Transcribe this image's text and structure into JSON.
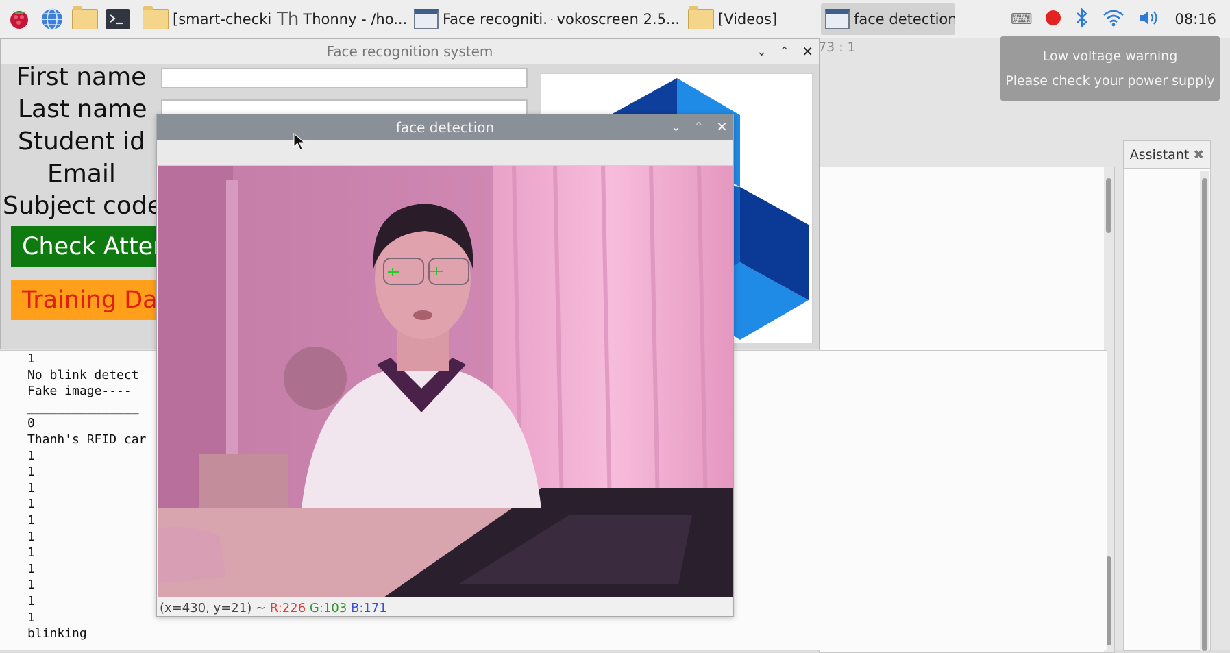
{
  "taskbar": {
    "tasks": [
      {
        "label": "[smart-checkin...",
        "icon": "folder-icon"
      },
      {
        "label": "Thonny  -  /ho...",
        "icon": "thonny-icon"
      },
      {
        "label": "Face recogniti...",
        "icon": "window-icon"
      },
      {
        "label": "vokoscreen 2.5...",
        "icon": "vokoscreen-icon"
      },
      {
        "label": "[Videos]",
        "icon": "folder-icon"
      },
      {
        "label": "face detection",
        "icon": "window-icon",
        "active": true
      }
    ],
    "clock": "08:16"
  },
  "notification": {
    "line1": "Low voltage warning",
    "line2": "Please check your power supply"
  },
  "thonny": {
    "cursor_pos": "73 : 1",
    "assistant_tab": "Assistant",
    "shell_lines": [
      "1",
      "No blink detect",
      "Fake image----",
      "_______________",
      "0",
      "Thanh's RFID car",
      "1",
      "1",
      "1",
      "1",
      "1",
      "1",
      "1",
      "1",
      "1",
      "1",
      "1",
      "blinking"
    ]
  },
  "face_recognition_window": {
    "title": "Face recognition system",
    "labels": {
      "first_name": "First name",
      "last_name": "Last name",
      "student_id": "Student id",
      "email": "Email",
      "subject_code": "Subject code"
    },
    "buttons": {
      "check_attendance": "Check Atten",
      "training_data": "Training Da"
    },
    "colors": {
      "check_button": "#0e7a10",
      "training_button": "#ff9f1a",
      "training_text": "#e11f10"
    }
  },
  "face_detection_window": {
    "title": "face detection",
    "status": {
      "coords": "(x=430, y=21) ~",
      "r": "R:226",
      "g": "G:103",
      "b": "B:171"
    }
  }
}
